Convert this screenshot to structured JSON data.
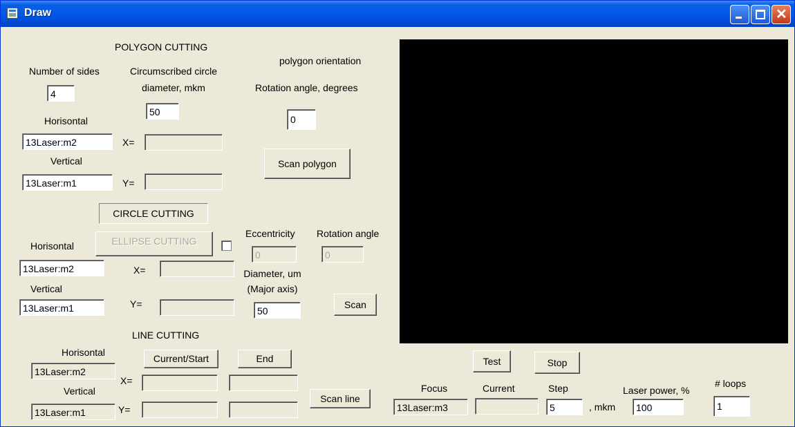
{
  "window": {
    "title": "Draw"
  },
  "polygon": {
    "heading": "POLYGON CUTTING",
    "sides_label": "Number of sides",
    "sides_value": "4",
    "circle_label_1": "Circumscribed circle",
    "circle_label_2": "diameter, mkm",
    "diameter_value": "50",
    "orientation_label": "polygon orientation",
    "rotation_label": "Rotation angle, degrees",
    "rotation_value": "0",
    "horiz_label": "Horisontal",
    "horiz_value": "13Laser:m2",
    "x_label": "X=",
    "x_value": "",
    "vert_label": "Vertical",
    "vert_value": "13Laser:m1",
    "y_label": "Y=",
    "y_value": "",
    "scan_button": "Scan polygon"
  },
  "circle": {
    "heading": "CIRCLE CUTTING",
    "ellipse_button": "ELLIPSE CUTTING",
    "eccentricity_label": "Eccentricity",
    "eccentricity_value": "0",
    "rotation_label": "Rotation angle",
    "rotation_value": "0",
    "horiz_label": "Horisontal",
    "horiz_value": "13Laser:m2",
    "x_label": "X=",
    "x_value": "",
    "diameter_label_1": "Diameter, um",
    "diameter_label_2": "(Major axis)",
    "diameter_value": "50",
    "vert_label": "Vertical",
    "vert_value": "13Laser:m1",
    "y_label": "Y=",
    "y_value": "",
    "scan_button": "Scan"
  },
  "line": {
    "heading": "LINE CUTTING",
    "horiz_label": "Horisontal",
    "horiz_value": "13Laser:m2",
    "vert_label": "Vertical",
    "vert_value": "13Laser:m1",
    "start_button": "Current/Start",
    "end_button": "End",
    "x_label": "X=",
    "y_label": "Y=",
    "x_start": "",
    "x_end": "",
    "y_start": "",
    "y_end": "",
    "scan_button": "Scan line"
  },
  "controls": {
    "test_button": "Test",
    "stop_button": "Stop",
    "focus_label": "Focus",
    "focus_value": "13Laser:m3",
    "current_label": "Current",
    "current_value": "",
    "step_label": "Step",
    "step_value": "5",
    "step_unit": ", mkm",
    "power_label": "Laser power, %",
    "power_value": "100",
    "loops_label": "# loops",
    "loops_value": "1"
  }
}
